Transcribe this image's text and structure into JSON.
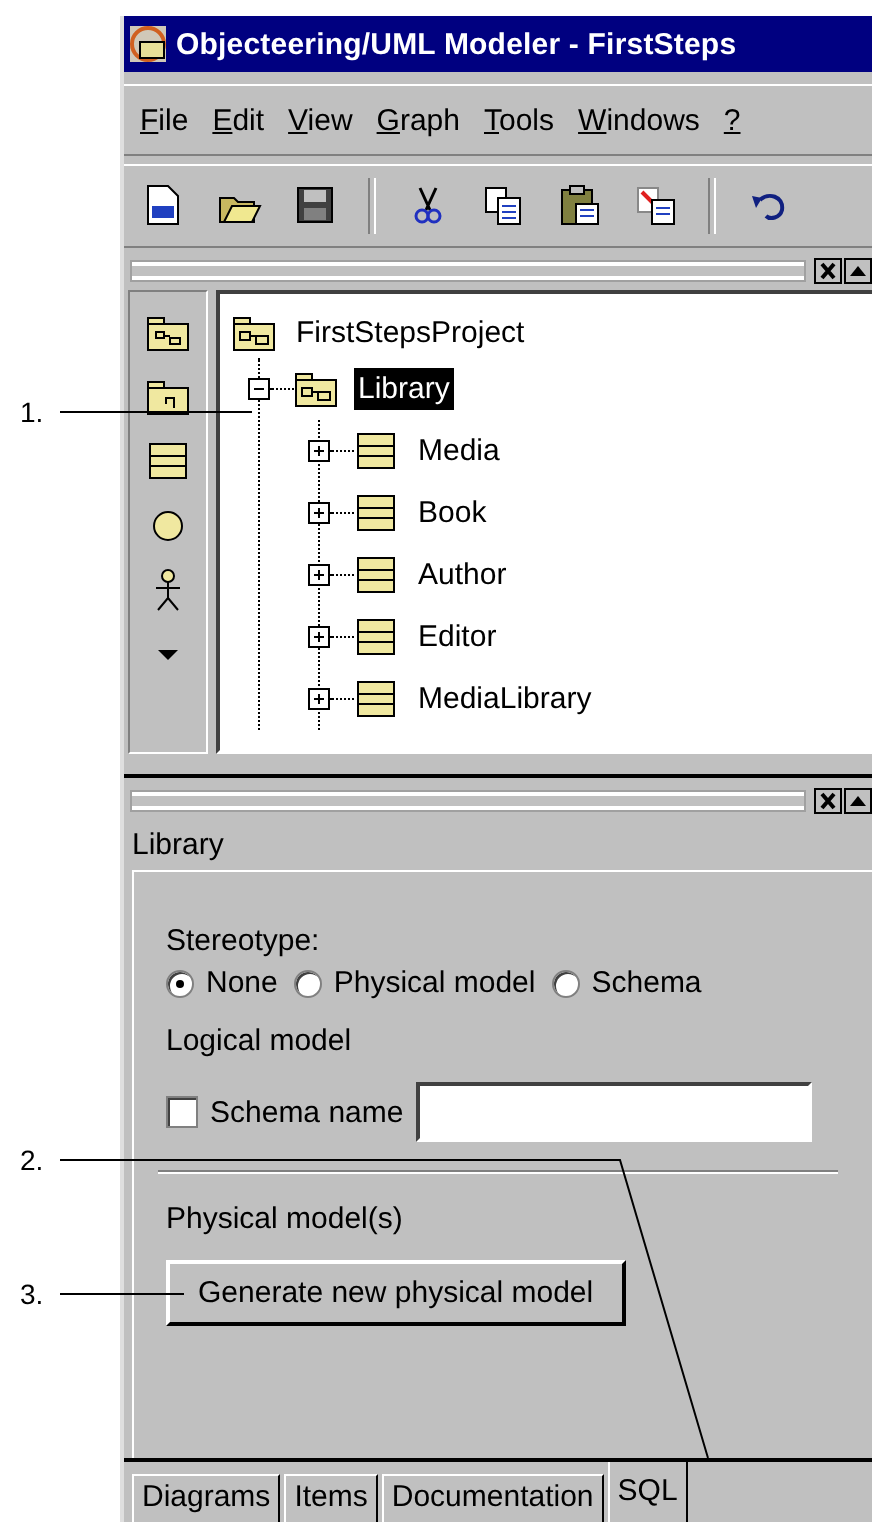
{
  "window": {
    "title": "Objecteering/UML Modeler - FirstSteps"
  },
  "menu": [
    {
      "label": "File",
      "underline_first": true
    },
    {
      "label": "Edit",
      "underline_first": true
    },
    {
      "label": "View",
      "underline_first": true
    },
    {
      "label": "Graph",
      "underline_first": true
    },
    {
      "label": "Tools",
      "underline_first": true
    },
    {
      "label": "Windows",
      "underline_first": true
    },
    {
      "label": "?",
      "underline_first": true
    }
  ],
  "tree": {
    "label": "FirstStepsProject",
    "kind": "package",
    "selected": false,
    "children": [
      {
        "label": "Library",
        "kind": "package",
        "expanded": true,
        "selected": true,
        "children": [
          {
            "label": "Media",
            "kind": "class",
            "expanded": false,
            "selected": false
          },
          {
            "label": "Book",
            "kind": "class",
            "expanded": false,
            "selected": false
          },
          {
            "label": "Author",
            "kind": "class",
            "expanded": false,
            "selected": false
          },
          {
            "label": "Editor",
            "kind": "class",
            "expanded": false,
            "selected": false
          },
          {
            "label": "MediaLibrary",
            "kind": "class",
            "expanded": false,
            "selected": false
          }
        ]
      }
    ]
  },
  "properties": {
    "title": "Library",
    "stereotype_label": "Stereotype:",
    "stereotypes": [
      {
        "label": "None",
        "selected": true
      },
      {
        "label": "Physical model",
        "selected": false
      },
      {
        "label": "Schema",
        "selected": false
      }
    ],
    "logical_label": "Logical model",
    "schema_checkbox": {
      "label": "Schema name",
      "checked": false
    },
    "physical_label": "Physical model(s)",
    "generate_button": "Generate new physical model"
  },
  "tabs": [
    {
      "label": "Diagrams",
      "selected": false
    },
    {
      "label": "Items",
      "selected": false
    },
    {
      "label": "Documentation",
      "selected": false
    },
    {
      "label": "SQL",
      "selected": true
    }
  ],
  "callouts": [
    {
      "label": "1."
    },
    {
      "label": "2."
    },
    {
      "label": "3."
    }
  ]
}
